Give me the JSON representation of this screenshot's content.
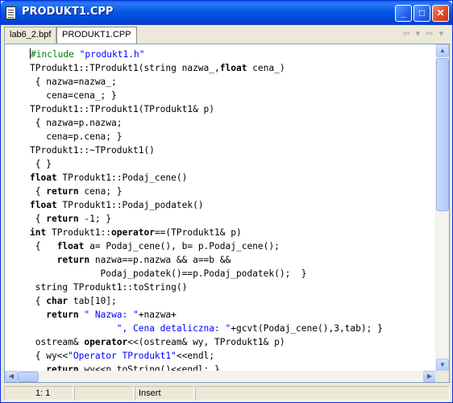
{
  "window": {
    "title": "PRODUKT1.CPP",
    "minimize_glyph": "_",
    "maximize_glyph": "□",
    "close_glyph": "✕"
  },
  "tabs": [
    {
      "label": "lab6_2.bpf",
      "active": false
    },
    {
      "label": "PRODUKT1.CPP",
      "active": true
    }
  ],
  "nav": {
    "back_glyph": "⇦ ▾",
    "forward_glyph": "⇨ ▾"
  },
  "code_lines": [
    [
      {
        "t": "pp",
        "v": "#include "
      },
      {
        "t": "str",
        "v": "\"produkt1.h\""
      }
    ],
    [
      {
        "t": "n",
        "v": "TProdukt1::TProdukt1(string nazwa_,"
      },
      {
        "t": "kw",
        "v": "float"
      },
      {
        "t": "n",
        "v": " cena_)"
      }
    ],
    [
      {
        "t": "n",
        "v": " { nazwa=nazwa_;"
      }
    ],
    [
      {
        "t": "n",
        "v": "   cena=cena_; }"
      }
    ],
    [
      {
        "t": "n",
        "v": "TProdukt1::TProdukt1(TProdukt1& p)"
      }
    ],
    [
      {
        "t": "n",
        "v": " { nazwa=p.nazwa;"
      }
    ],
    [
      {
        "t": "n",
        "v": "   cena=p.cena; }"
      }
    ],
    [
      {
        "t": "n",
        "v": "TProdukt1::~TProdukt1()"
      }
    ],
    [
      {
        "t": "n",
        "v": " { }"
      }
    ],
    [
      {
        "t": "kw",
        "v": "float"
      },
      {
        "t": "n",
        "v": " TProdukt1::Podaj_cene()"
      }
    ],
    [
      {
        "t": "n",
        "v": " { "
      },
      {
        "t": "kw",
        "v": "return"
      },
      {
        "t": "n",
        "v": " cena; }"
      }
    ],
    [
      {
        "t": "kw",
        "v": "float"
      },
      {
        "t": "n",
        "v": " TProdukt1::Podaj_podatek()"
      }
    ],
    [
      {
        "t": "n",
        "v": " { "
      },
      {
        "t": "kw",
        "v": "return"
      },
      {
        "t": "n",
        "v": " -1; }"
      }
    ],
    [
      {
        "t": "kw",
        "v": "int"
      },
      {
        "t": "n",
        "v": " TProdukt1::"
      },
      {
        "t": "kw",
        "v": "operator"
      },
      {
        "t": "n",
        "v": "==(TProdukt1& p)"
      }
    ],
    [
      {
        "t": "n",
        "v": " {   "
      },
      {
        "t": "kw",
        "v": "float"
      },
      {
        "t": "n",
        "v": " a= Podaj_cene(), b= p.Podaj_cene();"
      }
    ],
    [
      {
        "t": "n",
        "v": "     "
      },
      {
        "t": "kw",
        "v": "return"
      },
      {
        "t": "n",
        "v": " nazwa==p.nazwa && a==b &&"
      }
    ],
    [
      {
        "t": "n",
        "v": "             Podaj_podatek()==p.Podaj_podatek();  }"
      }
    ],
    [
      {
        "t": "n",
        "v": " string TProdukt1::toString()"
      }
    ],
    [
      {
        "t": "n",
        "v": " { "
      },
      {
        "t": "kw",
        "v": "char"
      },
      {
        "t": "n",
        "v": " tab[10];"
      }
    ],
    [
      {
        "t": "n",
        "v": "   "
      },
      {
        "t": "kw",
        "v": "return"
      },
      {
        "t": "n",
        "v": " "
      },
      {
        "t": "str",
        "v": "\" Nazwa: \""
      },
      {
        "t": "n",
        "v": "+nazwa+"
      }
    ],
    [
      {
        "t": "n",
        "v": "                "
      },
      {
        "t": "str",
        "v": "\", Cena detaliczna: \""
      },
      {
        "t": "n",
        "v": "+gcvt(Podaj_cene(),3,tab); }"
      }
    ],
    [
      {
        "t": "n",
        "v": " ostream& "
      },
      {
        "t": "kw",
        "v": "operator"
      },
      {
        "t": "n",
        "v": "<<(ostream& wy, TProdukt1& p)"
      }
    ],
    [
      {
        "t": "n",
        "v": " { wy<<"
      },
      {
        "t": "str",
        "v": "\"Operator TProdukt1\""
      },
      {
        "t": "n",
        "v": "<<endl;"
      }
    ],
    [
      {
        "t": "n",
        "v": "   "
      },
      {
        "t": "kw",
        "v": "return"
      },
      {
        "t": "n",
        "v": " wy<<p.toString()<<endl; }"
      }
    ]
  ],
  "statusbar": {
    "position": "1:   1",
    "modified": "",
    "mode": "Insert"
  }
}
